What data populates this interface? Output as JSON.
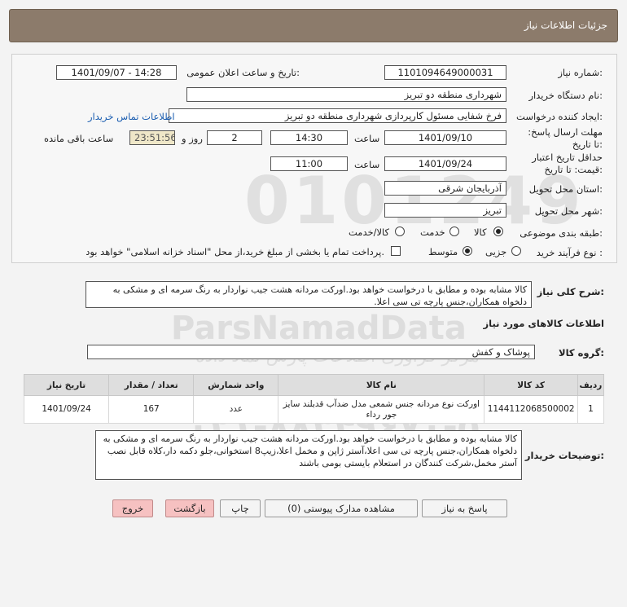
{
  "page_title": "جزئیات اطلاعات نیاز",
  "watermark": {
    "brand": "ParsNamadData",
    "persian": "مرکز فرآوری اطلاعات پارس نماد داده",
    "phone": "۰۲۱-۸۸۳۴۹۶۷۰-۵",
    "code": "0101249"
  },
  "labels": {
    "need_number": "شماره نیاز:",
    "announce_datetime": "تاریخ و ساعت اعلان عمومی:",
    "buyer_org": "نام دستگاه خریدار:",
    "requester": "ایجاد کننده درخواست:",
    "contact_link": "اطلاعات تماس خریدار",
    "reply_deadline": "مهلت ارسال پاسخ: تا تاریخ:",
    "time": "ساعت",
    "days_and": "روز و",
    "remaining": "ساعت باقی مانده",
    "price_validity": "حداقل تاریخ اعتبار قیمت: تا تاریخ:",
    "delivery_province": "استان محل تحویل:",
    "delivery_city": "شهر محل تحویل:",
    "category": "طبقه بندی موضوعی:",
    "purchase_type": "نوع فرآیند خرید :",
    "general_desc": "شرح کلی نیاز:",
    "goods_info": "اطلاعات کالاهای مورد نیاز",
    "goods_group": "گروه کالا:",
    "buyer_notes": "توضیحات خریدار:"
  },
  "values": {
    "need_number": "1101094649000031",
    "announce_datetime": "1401/09/07 - 14:28",
    "buyer_org": "شهرداری منطقه دو تبریز",
    "requester": "فرخ شفایی مسئول کارپردازی شهرداری منطقه دو تبریز",
    "reply_date": "1401/09/10",
    "reply_time": "14:30",
    "reply_days": "2",
    "reply_remaining": "23:51:56",
    "validity_date": "1401/09/24",
    "validity_time": "11:00",
    "province": "آذربایجان شرقی",
    "city": "تبریز",
    "goods_group": "پوشاک و کفش",
    "general_desc": "کالا مشابه بوده و مطابق با درخواست خواهد بود.اورکت مردانه هشت جیب نواردار به رنگ سرمه ای و مشکی به دلخواه همکاران،جنس پارچه تی سی اعلا.",
    "buyer_notes": "کالا مشابه بوده و مطابق با درخواست خواهد بود.اورکت مردانه هشت جیب نواردار به رنگ سرمه ای و مشکی به دلخواه همکاران،جنس پارچه تی سی اعلا،آستر ژاپن و مخمل اعلا،زیپ8 استخوانی،جلو دکمه دار،کلاه قابل نصب آستر مخمل،شرکت کنندگان در استعلام بایستی بومی باشند"
  },
  "category_options": [
    {
      "label": "کالا",
      "selected": true
    },
    {
      "label": "خدمت",
      "selected": false
    },
    {
      "label": "کالا/خدمت",
      "selected": false
    }
  ],
  "purchase_options": [
    {
      "label": "جزیی",
      "selected": false
    },
    {
      "label": "متوسط",
      "selected": true
    }
  ],
  "treasury_note": "پرداخت تمام یا بخشی از مبلغ خرید،از محل \"اسناد خزانه اسلامی\" خواهد بود.",
  "table": {
    "headers": [
      "ردیف",
      "کد کالا",
      "نام کالا",
      "واحد شمارش",
      "تعداد / مقدار",
      "تاریخ نیاز"
    ],
    "rows": [
      [
        "1",
        "1144112068500002",
        "اورکت نوع مردانه جنس شمعی مدل ضدآب قدبلند سایز جور رداء",
        "عدد",
        "167",
        "1401/09/24"
      ]
    ]
  },
  "buttons": {
    "reply": "پاسخ به نیاز",
    "attachments": "مشاهده مدارک پیوستی (0)",
    "print": "چاپ",
    "back": "بازگشت",
    "exit": "خروج"
  }
}
